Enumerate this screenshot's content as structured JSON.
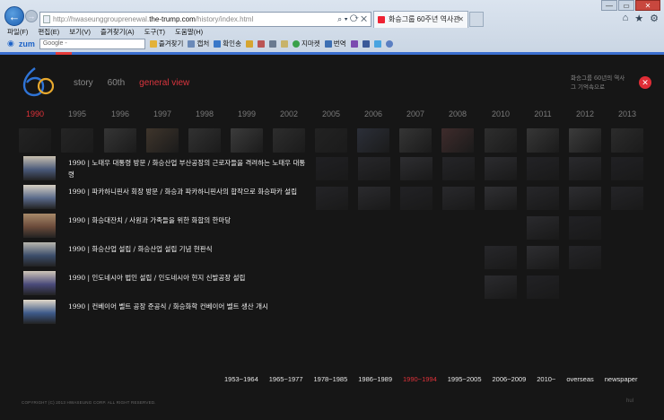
{
  "browser": {
    "address_prefix": "http://hwaseunggrouprenewal.",
    "address_domain": "the-trump.com",
    "address_suffix": "/history/index.html",
    "address_tools": "⌕ ▾ ⟳ ✕",
    "tab_title": "화승그룹 60주년 역사관",
    "tab_close": "✕",
    "menu": [
      "파일(F)",
      "편집(E)",
      "보기(V)",
      "즐겨찾기(A)",
      "도구(T)",
      "도움말(H)"
    ],
    "toolbar": {
      "zum": "zum",
      "google_placeholder": "Google -",
      "favorites": "즐겨찾기",
      "capture": "캡처",
      "dict": "확인송",
      "map": "지마켓",
      "translate": "번역"
    },
    "win_controls": [
      "—",
      "▭",
      "✕"
    ]
  },
  "site": {
    "logo_text": "60",
    "nav": [
      {
        "label": "story",
        "active": false
      },
      {
        "label": "60th",
        "active": false
      },
      {
        "label": "general view",
        "active": true
      }
    ],
    "slogan": "화승그룹 60년의 역사\n그 기억속으로",
    "close_label": "✕",
    "years": [
      "1990",
      "1995",
      "1996",
      "1997",
      "1998",
      "1999",
      "2002",
      "2005",
      "2006",
      "2007",
      "2008",
      "2010",
      "2011",
      "2012",
      "2013"
    ],
    "active_year": "1990",
    "entries": [
      {
        "text": "1990  |  노태우 대통령 방문  /  화승산업 부산공장의 근로자들을 격려하는 노태우 대통령"
      },
      {
        "text": "1990  |  파카하니핀사 회장 방문  /  화승과 파카하니핀사의 합작으로 화승파카 설립"
      },
      {
        "text": "1990  |  화승대잔치  /  사원과 가족들을 위한 화합의 한마당"
      },
      {
        "text": "1990  |  화승산업 설립  /  화승산업 설립 기념 현판식"
      },
      {
        "text": "1990  |  인도네시아 법인 설립  /  인도네시아 현지 신발공장 설립"
      },
      {
        "text": "1990  |  컨베이어 벨트 공장 준공식  /  화승화학 컨베이어 벨트 생산 개시"
      }
    ],
    "eras": [
      {
        "label": "1953~1964",
        "active": false
      },
      {
        "label": "1965~1977",
        "active": false
      },
      {
        "label": "1978~1985",
        "active": false
      },
      {
        "label": "1986~1989",
        "active": false
      },
      {
        "label": "1990~1994",
        "active": true
      },
      {
        "label": "1995~2005",
        "active": false
      },
      {
        "label": "2006~2009",
        "active": false
      },
      {
        "label": "2010~",
        "active": false
      },
      {
        "label": "overseas",
        "active": false
      },
      {
        "label": "newspaper",
        "active": false
      }
    ],
    "copyright": "COPYRIGHT (C) 2013 HWASEUNG CORP. ALL RIGHT RESERVED.",
    "brand_mark": "hul"
  },
  "colors": {
    "accent": "#e0323a",
    "page_bg": "#161616",
    "ie_blue": "#3b6fd0"
  }
}
